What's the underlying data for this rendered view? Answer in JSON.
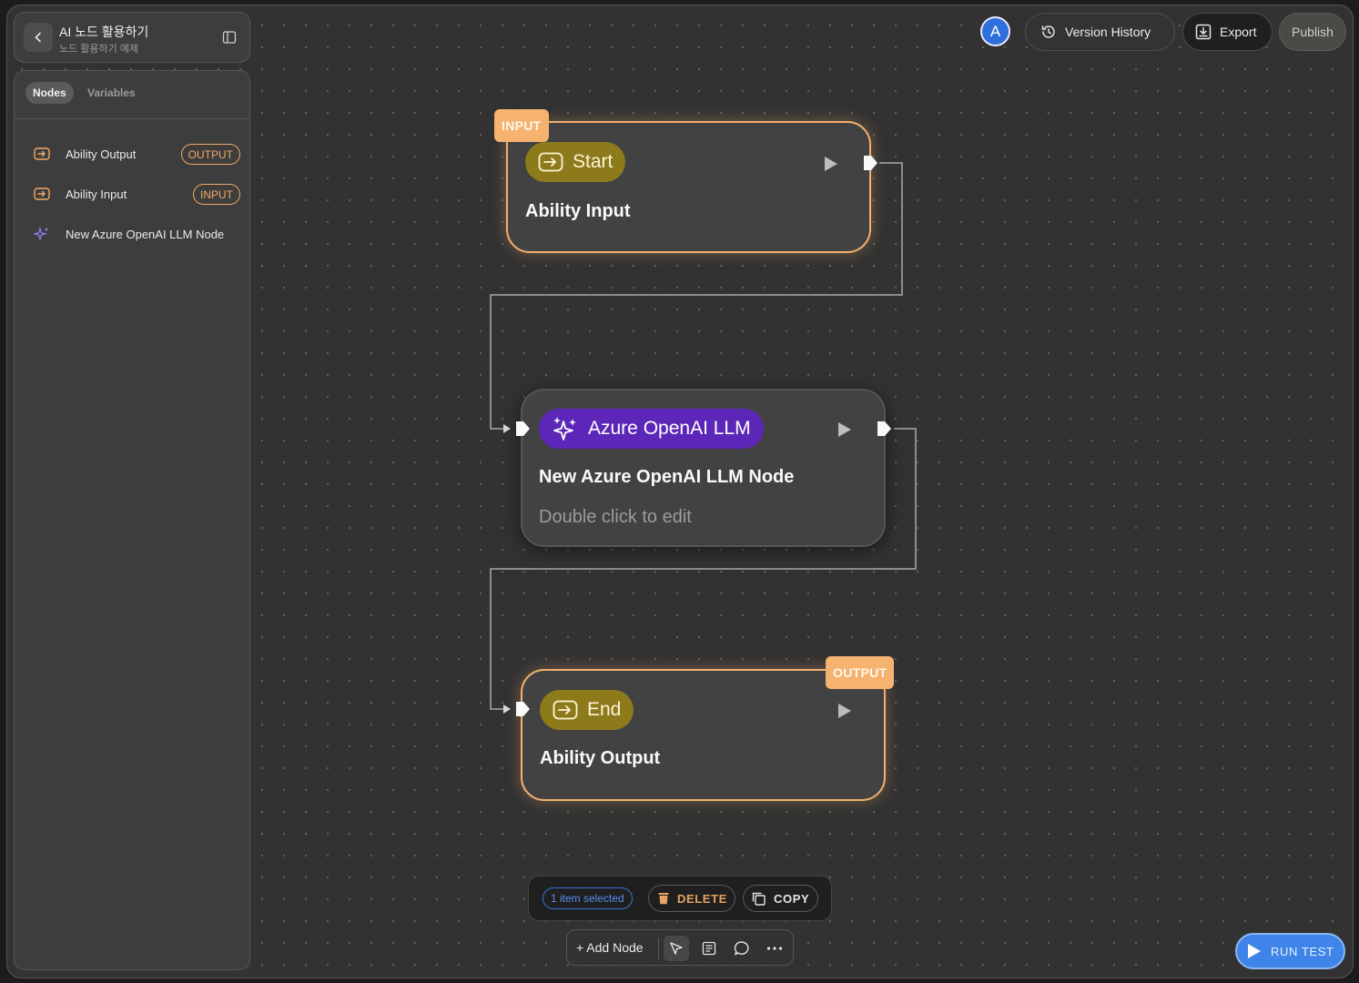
{
  "project": {
    "title": "AI 노드 활용하기",
    "subtitle": "노드 활용하기 예제"
  },
  "sidebar": {
    "tabs": [
      {
        "label": "Nodes",
        "active": true
      },
      {
        "label": "Variables",
        "active": false
      }
    ],
    "items": [
      {
        "label": "Ability Output",
        "badge": "OUTPUT",
        "icon": "enter-box-icon"
      },
      {
        "label": "Ability Input",
        "badge": "INPUT",
        "icon": "enter-box-icon"
      },
      {
        "label": "New Azure OpenAI LLM Node",
        "badge": "",
        "icon": "sparkle-icon"
      }
    ]
  },
  "topbar": {
    "avatar_initial": "A",
    "version_history_label": "Version History",
    "export_label": "Export",
    "publish_label": "Publish"
  },
  "nodes": {
    "start": {
      "tag": "INPUT",
      "type_label": "Start",
      "title": "Ability Input"
    },
    "llm": {
      "type_label": "Azure OpenAI LLM",
      "title": "New Azure OpenAI LLM Node",
      "hint": "Double click to edit"
    },
    "end": {
      "tag": "OUTPUT",
      "type_label": "End",
      "title": "Ability Output"
    }
  },
  "selection": {
    "count_label": "1 item selected",
    "delete_label": "DELETE",
    "copy_label": "COPY"
  },
  "toolbar": {
    "add_node_label": "+ Add Node"
  },
  "run_test_label": "RUN TEST",
  "colors": {
    "accent_orange": "#f6b26f",
    "start_pill": "#8c7a1b",
    "llm_pill": "#5c26b8",
    "run_test": "#3f84e8",
    "avatar": "#2f6fdc"
  }
}
